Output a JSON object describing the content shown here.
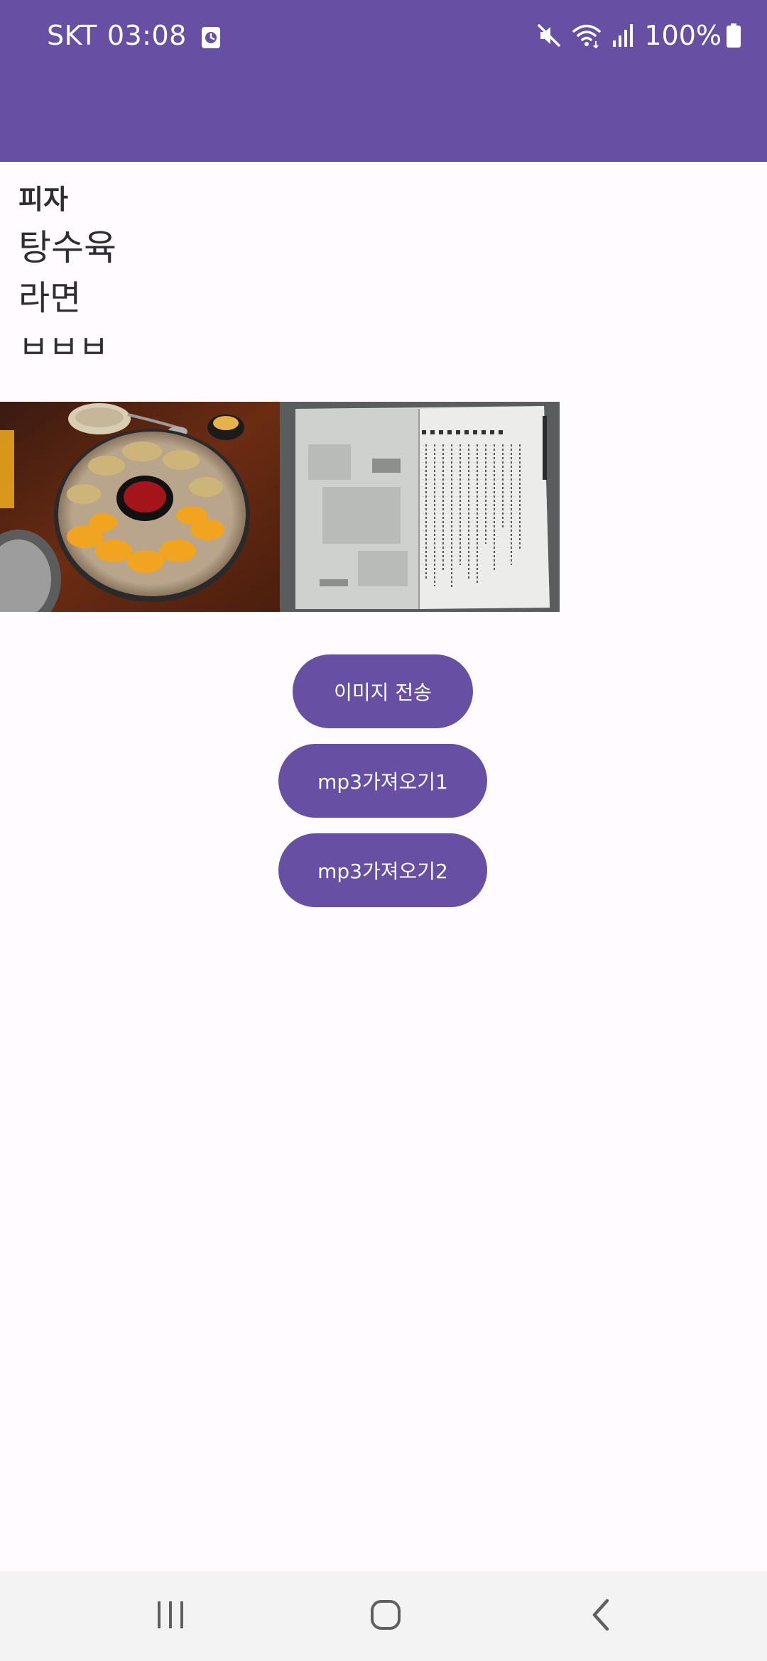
{
  "status_bar": {
    "carrier": "SKT",
    "time": "03:08",
    "battery": "100%",
    "icons": [
      "alarm-icon",
      "mute-icon",
      "wifi-icon",
      "signal-icon",
      "battery-icon"
    ]
  },
  "text_lines": [
    "피자",
    "탕수육",
    "라면",
    "ㅂㅂㅂ"
  ],
  "images": [
    {
      "name": "food-photo",
      "description_icon": "dumplings-and-shrimp-photo"
    },
    {
      "name": "book-photo",
      "description_icon": "open-book-photo"
    }
  ],
  "buttons": {
    "send_image": "이미지 전송",
    "get_mp3_1": "mp3가져오기1",
    "get_mp3_2": "mp3가져오기2"
  },
  "nav_bar": {
    "icons": [
      "recents-icon",
      "home-icon",
      "back-icon"
    ]
  },
  "colors": {
    "primary": "#6750a4",
    "background": "#fffbfe",
    "nav_background": "#f3f3f3"
  }
}
